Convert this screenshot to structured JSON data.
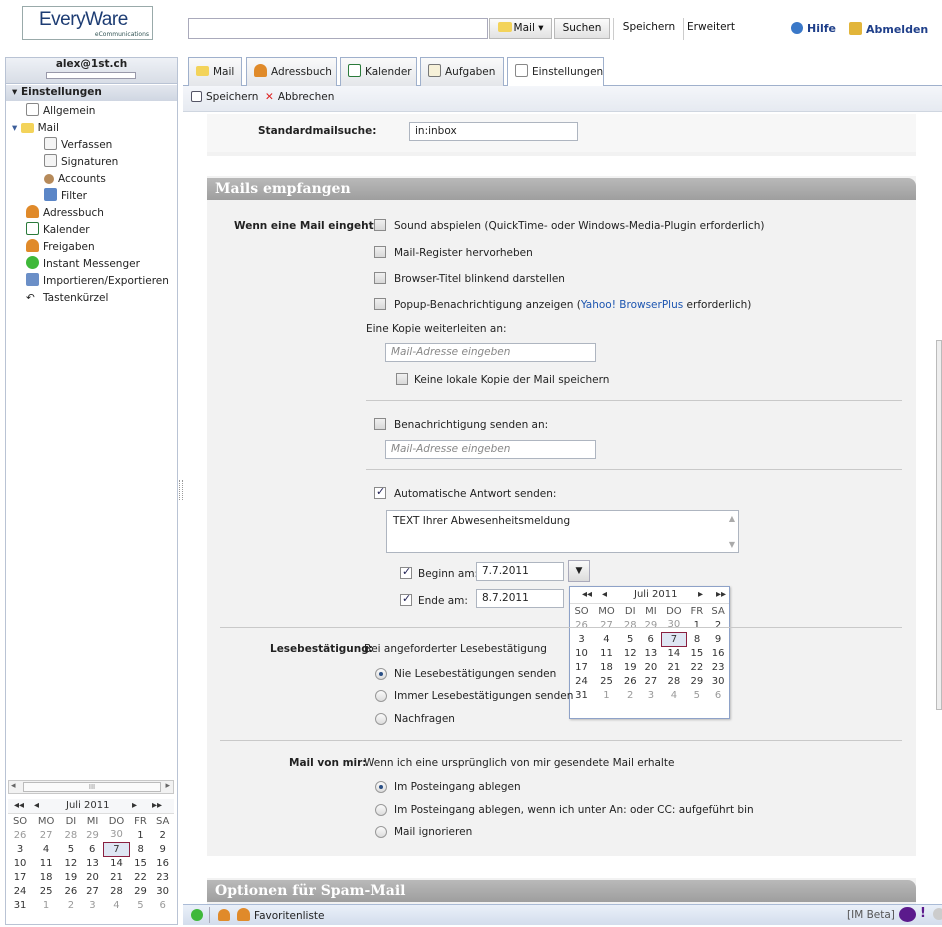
{
  "app": {
    "logo_text": "EveryWare",
    "logo_sub": "eCommunications",
    "search_placeholder": "",
    "scope_button": "Mail ▾",
    "search_button": "Suchen",
    "save_search_button": "Speichern",
    "advanced_button": "Erweitert",
    "help_link": "Hilfe",
    "logout_link": "Abmelden"
  },
  "sidebar": {
    "account": "alex@1st.ch",
    "section_title": "Einstellungen",
    "items": [
      {
        "label": "Allgemein",
        "icon": "page-icon"
      },
      {
        "label": "Mail",
        "icon": "mail-icon"
      },
      {
        "label": "Verfassen",
        "icon": "compose-icon"
      },
      {
        "label": "Signaturen",
        "icon": "signature-icon"
      },
      {
        "label": "Accounts",
        "icon": "accounts-icon"
      },
      {
        "label": "Filter",
        "icon": "filter-icon"
      },
      {
        "label": "Adressbuch",
        "icon": "addressbook-icon"
      },
      {
        "label": "Kalender",
        "icon": "calendar-icon"
      },
      {
        "label": "Freigaben",
        "icon": "share-icon"
      },
      {
        "label": "Instant Messenger",
        "icon": "messenger-icon"
      },
      {
        "label": "Importieren/Exportieren",
        "icon": "import-export-icon"
      },
      {
        "label": "Tastenkürzel",
        "icon": "shortcut-icon"
      }
    ],
    "scroll_grip": "III"
  },
  "calendar": {
    "month": "Juli 2011",
    "nav_first": "◂◂",
    "nav_prev": "◂",
    "nav_next": "▸",
    "nav_last": "▸▸",
    "weekdays": [
      "SO",
      "MO",
      "DI",
      "MI",
      "DO",
      "FR",
      "SA"
    ],
    "weeks": [
      [
        "26",
        "27",
        "28",
        "29",
        "30",
        "1",
        "2"
      ],
      [
        "3",
        "4",
        "5",
        "6",
        "7",
        "8",
        "9"
      ],
      [
        "10",
        "11",
        "12",
        "13",
        "14",
        "15",
        "16"
      ],
      [
        "17",
        "18",
        "19",
        "20",
        "21",
        "22",
        "23"
      ],
      [
        "24",
        "25",
        "26",
        "27",
        "28",
        "29",
        "30"
      ],
      [
        "31",
        "1",
        "2",
        "3",
        "4",
        "5",
        "6"
      ]
    ],
    "selected": "7"
  },
  "tabs": [
    {
      "label": "Mail",
      "icon": "mail-icon"
    },
    {
      "label": "Adressbuch",
      "icon": "addressbook-icon"
    },
    {
      "label": "Kalender",
      "icon": "calendar-icon"
    },
    {
      "label": "Aufgaben",
      "icon": "tasks-icon"
    },
    {
      "label": "Einstellungen",
      "icon": "settings-icon"
    }
  ],
  "toolbar": {
    "save": "Speichern",
    "cancel": "Abbrechen"
  },
  "settings": {
    "default_search_label": "Standardmailsuche:",
    "default_search_value": "in:inbox",
    "receive_title": "Mails empfangen",
    "on_mail_label": "Wenn eine Mail eingeht:",
    "opt_sound": "Sound abspielen (QuickTime- oder Windows-Media-Plugin erforderlich)",
    "opt_highlight": "Mail-Register hervorheben",
    "opt_blink": "Browser-Titel blinkend darstellen",
    "opt_popup_pre": "Popup-Benachrichtigung anzeigen (",
    "opt_popup_link": "Yahoo! BrowserPlus",
    "opt_popup_post": " erforderlich)",
    "forward_label": "Eine Kopie weiterleiten an:",
    "forward_placeholder": "Mail-Adresse eingeben",
    "no_local_copy": "Keine lokale Kopie der Mail speichern",
    "notify_label": "Benachrichtigung senden an:",
    "notify_placeholder": "Mail-Adresse eingeben",
    "auto_reply_label": "Automatische Antwort senden:",
    "auto_reply_text": "TEXT Ihrer Abwesenheitsmeldung",
    "begin_label": "Beginn am:",
    "begin_value": "7.7.2011",
    "end_label": "Ende am:",
    "end_value": "8.7.2011",
    "read_receipt_label": "Lesebestätigung:",
    "read_receipt_desc": "Bei angeforderter Lesebestätigung",
    "rr_never": "Nie Lesebestätigungen senden",
    "rr_always": "Immer Lesebestätigungen senden",
    "rr_ask": "Nachfragen",
    "from_me_label": "Mail von mir:",
    "from_me_desc": "Wenn ich eine ursprünglich von mir gesendete Mail erhalte",
    "fm_inbox": "Im Posteingang ablegen",
    "fm_inbox_cc": "Im Posteingang ablegen, wenn ich unter An: oder CC: aufgeführt bin",
    "fm_ignore": "Mail ignorieren",
    "spam_title": "Optionen für Spam-Mail"
  },
  "status": {
    "favorites": "Favoritenliste",
    "im_beta": "[IM Beta]"
  }
}
